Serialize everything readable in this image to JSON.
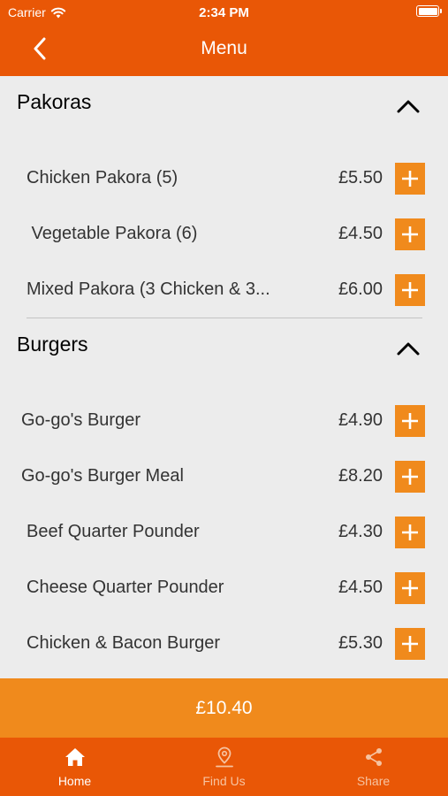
{
  "status_bar": {
    "carrier": "Carrier",
    "time": "2:34 PM"
  },
  "nav": {
    "title": "Menu"
  },
  "sections": [
    {
      "title": "Pakoras",
      "items": [
        {
          "name": "Chicken Pakora (5)",
          "price": "£5.50"
        },
        {
          "name": " Vegetable Pakora (6)",
          "price": "£4.50"
        },
        {
          "name": "Mixed Pakora (3 Chicken & 3...",
          "price": "£6.00"
        }
      ]
    },
    {
      "title": "Burgers",
      "items": [
        {
          "name": "Go-go's Burger",
          "price": "£4.90"
        },
        {
          "name": "Go-go's Burger Meal",
          "price": "£8.20"
        },
        {
          "name": "Beef Quarter Pounder",
          "price": "£4.30"
        },
        {
          "name": "Cheese Quarter Pounder",
          "price": "£4.50"
        },
        {
          "name": "Chicken & Bacon Burger",
          "price": "£5.30"
        }
      ]
    }
  ],
  "cart": {
    "total": "£10.40"
  },
  "tabs": [
    {
      "label": "Home",
      "icon": "home-icon",
      "active": true
    },
    {
      "label": "Find Us",
      "icon": "location-pin-icon",
      "active": false
    },
    {
      "label": "Share",
      "icon": "share-icon",
      "active": false
    }
  ],
  "colors": {
    "header": "#e95706",
    "accent": "#f08a1c",
    "background": "#ececec",
    "inactive_tab_text": "#f6c3a1"
  }
}
